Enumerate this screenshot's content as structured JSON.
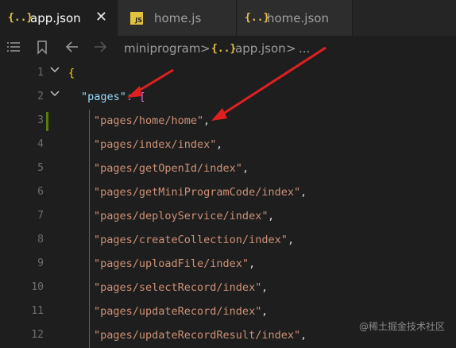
{
  "tabs": [
    {
      "label": "app.json",
      "icon": "{..}",
      "active": true,
      "close": "✕"
    },
    {
      "label": "home.js",
      "icon": "JS",
      "active": false
    },
    {
      "label": "home.json",
      "icon": "{..}",
      "active": false
    }
  ],
  "breadcrumb": {
    "folder": "miniprogram",
    "sep1": ">",
    "file_icon": "{..}",
    "file": "app.json",
    "sep2": ">",
    "more": "..."
  },
  "lines": [
    {
      "n": "1",
      "text": "{"
    },
    {
      "n": "2",
      "key": "\"pages\"",
      "rest": ": ["
    },
    {
      "n": "3",
      "str": "\"pages/home/home\"",
      "comma": ","
    },
    {
      "n": "4",
      "str": "\"pages/index/index\"",
      "comma": ","
    },
    {
      "n": "5",
      "str": "\"pages/getOpenId/index\"",
      "comma": ","
    },
    {
      "n": "6",
      "str": "\"pages/getMiniProgramCode/index\"",
      "comma": ","
    },
    {
      "n": "7",
      "str": "\"pages/deployService/index\"",
      "comma": ","
    },
    {
      "n": "8",
      "str": "\"pages/createCollection/index\"",
      "comma": ","
    },
    {
      "n": "9",
      "str": "\"pages/uploadFile/index\"",
      "comma": ","
    },
    {
      "n": "10",
      "str": "\"pages/selectRecord/index\"",
      "comma": ","
    },
    {
      "n": "11",
      "str": "\"pages/updateRecord/index\"",
      "comma": ","
    },
    {
      "n": "12",
      "str": "\"pages/updateRecordResult/index\"",
      "comma": ","
    }
  ],
  "watermark": "@稀土掘金技术社区",
  "colors": {
    "string": "#ce9178",
    "key": "#9cdcfe",
    "brace": "#ffd700",
    "bracket": "#da70d6",
    "arrow": "#e02020"
  }
}
